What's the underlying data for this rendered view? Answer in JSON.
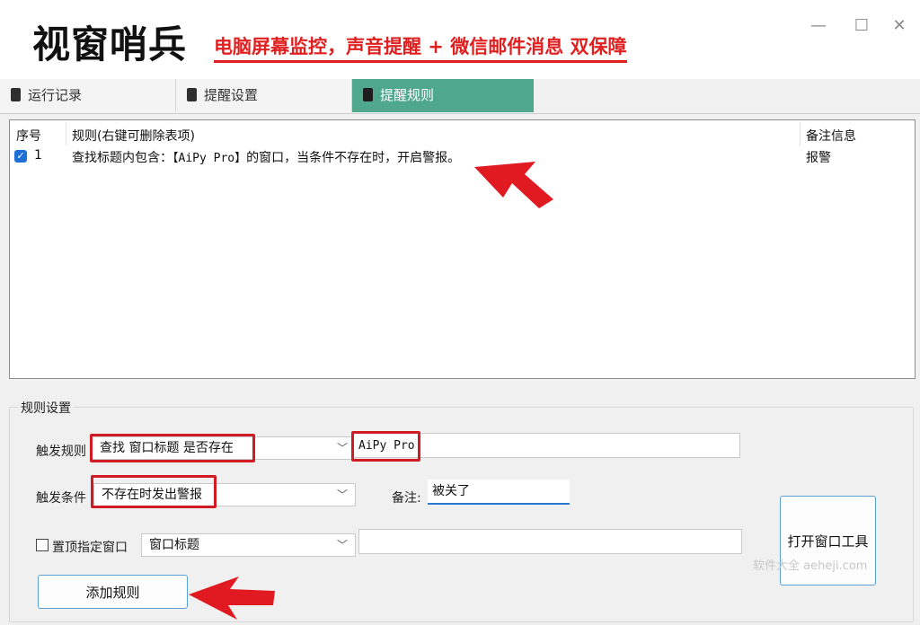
{
  "window": {
    "app_title": "视窗哨兵",
    "slogan": "电脑屏幕监控，声音提醒 + 微信邮件消息 双保障",
    "controls": {
      "minimize": "—",
      "maximize": "☐",
      "close": "✕"
    }
  },
  "tabs": [
    {
      "label": "运行记录",
      "active": false
    },
    {
      "label": "提醒设置",
      "active": false
    },
    {
      "label": "提醒规则",
      "active": true
    }
  ],
  "rule_list": {
    "columns": [
      "序号",
      "规则(右键可删除表项)",
      "备注信息"
    ],
    "rows": [
      {
        "checked": true,
        "index": "1",
        "rule_prefix": "查找标题内包含：",
        "rule_keyword": "【AiPy Pro】",
        "rule_suffix": "的窗口，当条件不存在时，开启警报。",
        "note": "报警"
      }
    ]
  },
  "settings": {
    "group_label": "规则设置",
    "trigger_rule": {
      "label": "触发规则",
      "selected": "查找 窗口标题 是否存在",
      "value": "AiPy Pro"
    },
    "trigger_condition": {
      "label": "触发条件",
      "selected": "不存在时发出警报"
    },
    "note": {
      "label": "备注:",
      "value": "被关了"
    },
    "pin_window": {
      "label": "置顶指定窗口",
      "checked": false,
      "selected": "窗口标题",
      "value": ""
    },
    "add_rule_button": "添加规则",
    "open_window_tool_button": "打开窗口工具"
  },
  "watermark": "软件大全 aeheji.com",
  "colors": {
    "accent_tab": "#4fa88c",
    "highlight_red": "#d11b24",
    "slogan_red": "#e02020"
  }
}
